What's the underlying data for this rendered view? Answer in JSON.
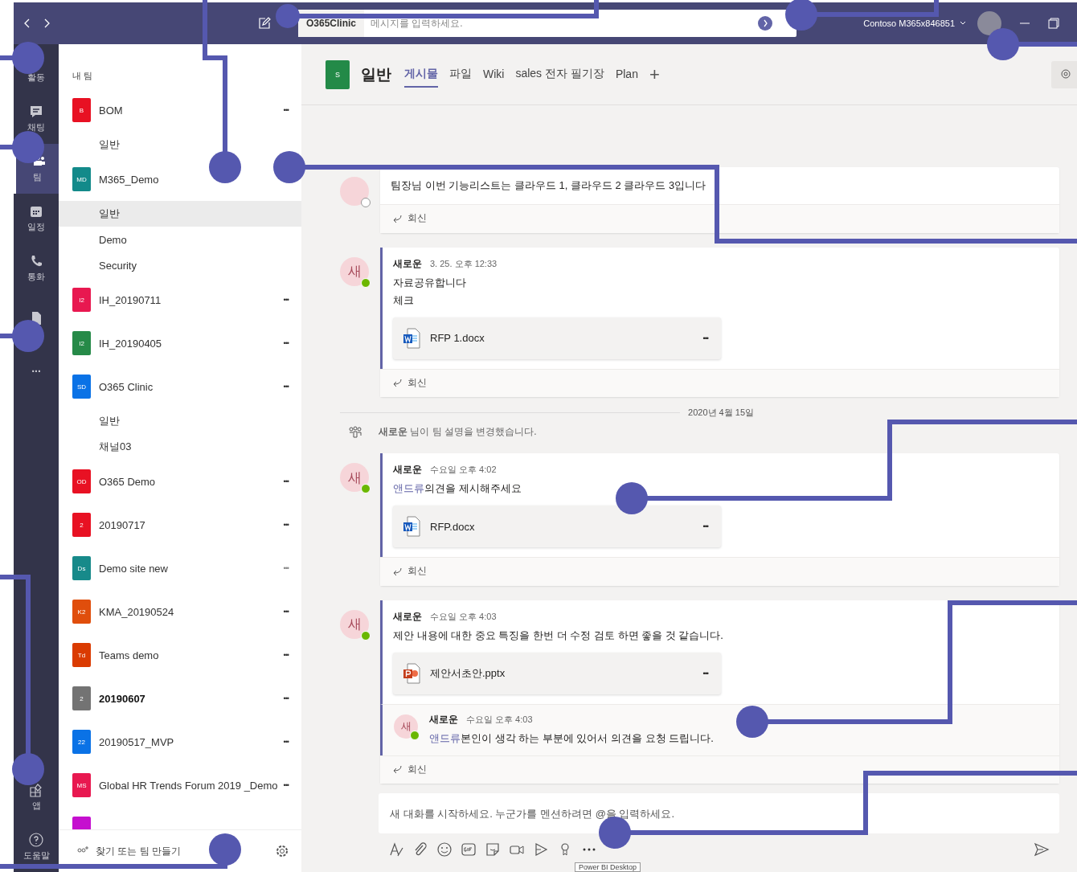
{
  "title_bar": {
    "search_scope": "O365Clinic",
    "search_placeholder": "메시지를 입력하세요.",
    "account": "Contoso M365x846851"
  },
  "rail": [
    {
      "label": "활동",
      "selected": false
    },
    {
      "label": "채팅",
      "selected": false
    },
    {
      "label": "팀",
      "selected": true
    },
    {
      "label": "일정",
      "selected": false
    },
    {
      "label": "통화",
      "selected": false
    },
    {
      "selected": false
    },
    {
      "label": "...",
      "selected": false
    }
  ],
  "rail_bottom": [
    {
      "label": "앱"
    },
    {
      "label": "도움말"
    }
  ],
  "team_list": {
    "heading": "내 팀",
    "teams": [
      {
        "initials": "B",
        "color": "#e81123",
        "name": "BOM",
        "bold": false,
        "more": "•••",
        "faded": false,
        "channels": [
          {
            "name": "일반",
            "selected": false
          }
        ]
      },
      {
        "initials": "MD",
        "color": "#138a8a",
        "name": "M365_Demo",
        "bold": false,
        "channels": [
          {
            "name": "일반",
            "selected": true
          },
          {
            "name": "Demo",
            "selected": false
          },
          {
            "name": "Security",
            "selected": false
          }
        ]
      },
      {
        "initials": "I2",
        "color": "#e81850",
        "name": "IH_20190711",
        "bold": false,
        "more": "•••",
        "faded": false
      },
      {
        "initials": "I2",
        "color": "#268a48",
        "name": "IH_20190405",
        "bold": false,
        "more": "•••",
        "faded": false
      },
      {
        "initials": "SD",
        "color": "#0a72e6",
        "name": "O365 Clinic",
        "bold": false,
        "more": "•••",
        "faded": false,
        "channels": [
          {
            "name": "일반",
            "selected": false
          },
          {
            "name": "채널03",
            "selected": false
          }
        ]
      },
      {
        "initials": "OD",
        "color": "#e81123",
        "name": "O365 Demo",
        "bold": false,
        "more": "•••",
        "faded": false
      },
      {
        "initials": "2",
        "color": "#e81123",
        "name": "20190717",
        "bold": false,
        "more": "•••",
        "faded": false
      },
      {
        "initials": "Ds",
        "color": "#178a8a",
        "name": "Demo site new",
        "bold": false,
        "more": "•••",
        "faded": true
      },
      {
        "initials": "K2",
        "color": "#e04e0c",
        "name": "KMA_20190524",
        "bold": false,
        "more": "•••",
        "faded": false
      },
      {
        "initials": "Td",
        "color": "#da3b01",
        "name": "Teams demo",
        "bold": false,
        "more": "•••",
        "faded": false
      },
      {
        "initials": "2",
        "color": "#737373",
        "name": "20190607",
        "bold": true,
        "more": "•••",
        "faded": false
      },
      {
        "initials": "22",
        "color": "#0a72e6",
        "name": "20190517_MVP",
        "bold": false,
        "more": "•••",
        "faded": false
      },
      {
        "initials": "MS",
        "color": "#e81850",
        "name": "Global HR Trends Forum 2019 _Demo",
        "bold": false,
        "more": "•••",
        "faded": false
      },
      {
        "color": "#c50fcf"
      }
    ],
    "footer": "찾기 또는 팀 만들기"
  },
  "channel_header": {
    "team_initial": "S",
    "channel": "일반",
    "tabs": [
      {
        "label": "게시물",
        "selected": true
      },
      {
        "label": "파일",
        "selected": false
      },
      {
        "label": "Wiki",
        "selected": false
      },
      {
        "label": "sales 전자 필기장",
        "selected": false
      },
      {
        "label": "Plan",
        "selected": false
      }
    ],
    "add": "+"
  },
  "feed": [
    {
      "kind": "message",
      "online": false,
      "text": "팀장님 이번 기능리스트는 클라우드 1, 클라우드 2 클라우드 3입니다",
      "reply": "회신"
    },
    {
      "kind": "message",
      "initial": "새",
      "online": true,
      "author": "새로운",
      "time": "3. 25. 오후 12:33",
      "lines": [
        "자료공유합니다",
        "체크"
      ],
      "attachment": {
        "kind": "word",
        "name": "RFP 1.docx",
        "more": "•••"
      },
      "reply": "회신"
    },
    {
      "kind": "date",
      "text": "2020년 4월 15일"
    },
    {
      "kind": "system",
      "text": "**새로운** 님이 팀 설명을 변경했습니다."
    },
    {
      "kind": "message",
      "initial": "새",
      "online": true,
      "author": "새로운",
      "time": "수요일 오후 4:02",
      "mention": "앤드류",
      "text": "의견을 제시해주세요",
      "attachment": {
        "kind": "word",
        "name": "RFP.docx",
        "more": "•••"
      },
      "reply": "회신"
    },
    {
      "kind": "message",
      "initial": "새",
      "online": true,
      "author": "새로운",
      "time": "수요일 오후 4:03",
      "text": "제안 내용에 대한 중요 특징을 한번 더 수정 검토 하면 좋을 것 같습니다.",
      "attachment": {
        "kind": "powerpoint",
        "name": "제안서초안.pptx",
        "more": "•••"
      },
      "replies": [
        {
          "initial": "새",
          "online": true,
          "author": "새로운",
          "time": "수요일 오후 4:03",
          "mention": "앤드류",
          "text": "본인이 생각 하는 부분에 있어서 의견을 요청 드립니다."
        }
      ],
      "reply": "회신"
    }
  ],
  "compose": {
    "placeholder": "새 대화를 시작하세요. 누군가를 멘션하려면 @을 입력하세요.",
    "tooltip": "Power BI Desktop"
  }
}
